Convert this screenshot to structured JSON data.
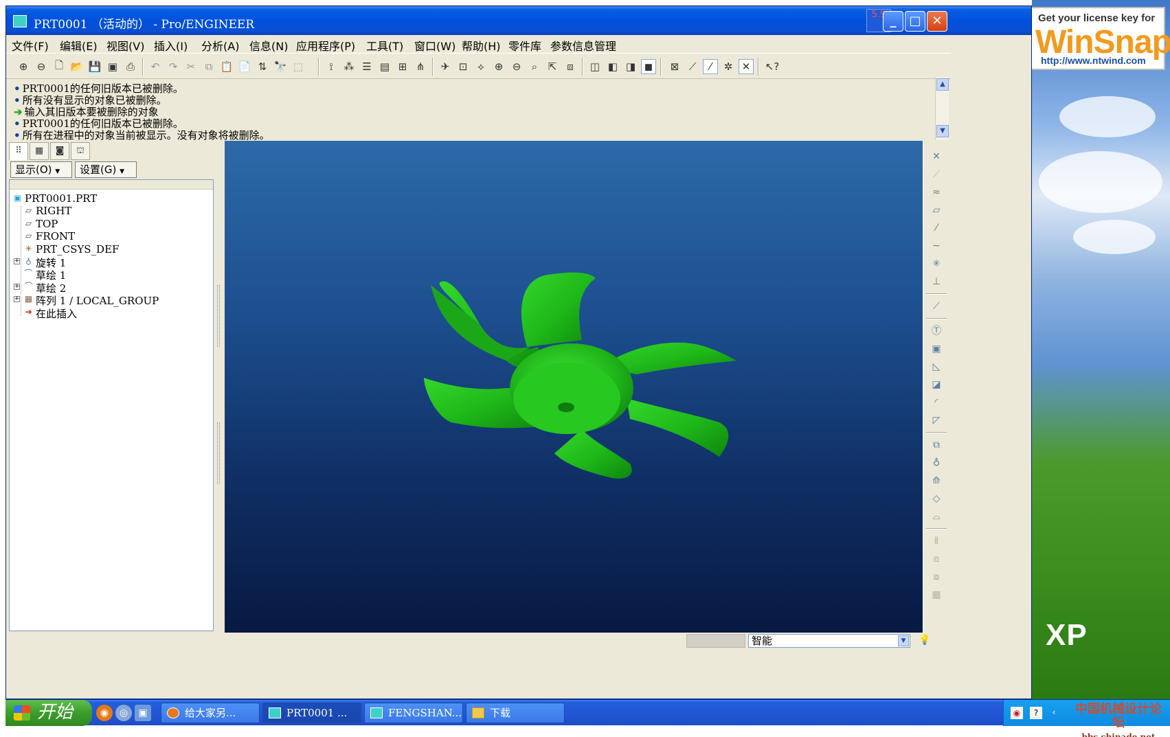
{
  "window": {
    "title": "PRT0001 （活动的） - Pro/ENGINEER",
    "num_indicator": "5.9"
  },
  "menubar": {
    "items": [
      "文件(F)",
      "编辑(E)",
      "视图(V)",
      "插入(I)",
      "分析(A)",
      "信息(N)",
      "应用程序(P)",
      "工具(T)",
      "窗口(W)",
      "帮助(H)",
      "零件库",
      "参数信息管理"
    ]
  },
  "messages": [
    {
      "text": "PRT0001的任何旧版本已被删除。",
      "kind": "info"
    },
    {
      "text": "所有没有显示的对象已被删除。",
      "kind": "info"
    },
    {
      "text": "输入其旧版本要被删除的对象",
      "kind": "prompt"
    },
    {
      "text": "PRT0001的任何旧版本已被删除。",
      "kind": "info"
    },
    {
      "text": "所有在进程中的对象当前被显示。没有对象将被删除。",
      "kind": "info"
    }
  ],
  "tree": {
    "show_button": "显示(O)",
    "settings_button": "设置(G)",
    "items": [
      {
        "label": "PRT0001.PRT",
        "icon": "part-icon",
        "indent": 0,
        "expander": ""
      },
      {
        "label": "RIGHT",
        "icon": "datum-plane-icon",
        "indent": 1,
        "expander": ""
      },
      {
        "label": "TOP",
        "icon": "datum-plane-icon",
        "indent": 1,
        "expander": ""
      },
      {
        "label": "FRONT",
        "icon": "datum-plane-icon",
        "indent": 1,
        "expander": ""
      },
      {
        "label": "PRT_CSYS_DEF",
        "icon": "csys-icon",
        "indent": 1,
        "expander": ""
      },
      {
        "label": "旋转 1",
        "icon": "revolve-icon",
        "indent": 1,
        "expander": "+"
      },
      {
        "label": "草绘 1",
        "icon": "sketch-icon",
        "indent": 1,
        "expander": ""
      },
      {
        "label": "草绘 2",
        "icon": "sketch-icon",
        "indent": 1,
        "expander": "+"
      },
      {
        "label": "阵列 1 / LOCAL_GROUP",
        "icon": "pattern-icon",
        "indent": 1,
        "expander": "+"
      },
      {
        "label": "在此插入",
        "icon": "insert-here-icon",
        "indent": 1,
        "expander": ""
      }
    ]
  },
  "status": {
    "filter": "智能"
  },
  "taskbar": {
    "start_label": "开始",
    "tasks": [
      {
        "label": "给大家另...",
        "icon": "firefox-icon",
        "active": false
      },
      {
        "label": "PRT0001 ...",
        "icon": "proe-icon",
        "active": true
      },
      {
        "label": "FENGSHAN...",
        "icon": "proe-icon",
        "active": false
      },
      {
        "label": "下载",
        "icon": "folder-icon",
        "active": false
      }
    ]
  },
  "watermarks": {
    "winsnap_line1": "Get your license key for",
    "winsnap_line2": "WinSnap",
    "winsnap_line3": "http://www.ntwind.com",
    "xp": "XP",
    "forum_name": "中国机械设计论坛",
    "forum_url": "bbs.chinade.net"
  },
  "colors": {
    "model": "#22c21c",
    "viewport_top": "#2d6aa8",
    "viewport_bottom": "#071941",
    "titlebar": "#0050dd"
  }
}
